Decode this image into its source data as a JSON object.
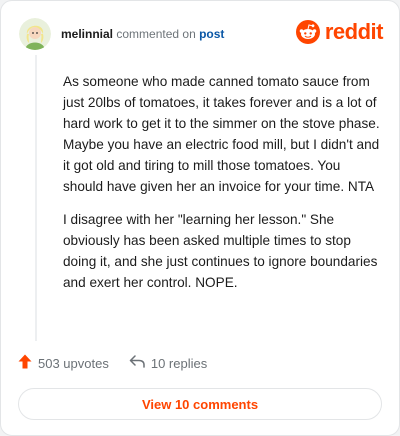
{
  "header": {
    "username": "melinnial",
    "action_text": "commented on",
    "post_link": "post"
  },
  "brand": {
    "name": "reddit",
    "color": "#ff4500",
    "icon": "reddit-alien-icon"
  },
  "comment": {
    "paragraphs": [
      "As someone who made canned tomato sauce from just 20lbs of tomatoes, it takes forever and is a lot of hard work to get it to the simmer on the stove phase. Maybe you have an electric food mill, but I didn't and it got old and tiring to mill those tomatoes. You should have given her an invoice for your time. NTA",
      "I disagree with her \"learning her lesson.\" She obviously has been asked multiple times to stop doing it, and she just continues to ignore boundaries and exert her control. NOPE."
    ]
  },
  "footer": {
    "upvotes_label": "503 upvotes",
    "replies_label": "10 replies",
    "upvote_icon": "upvote-arrow-icon",
    "reply_icon": "reply-arrow-icon"
  },
  "view_button": {
    "label": "View 10 comments"
  }
}
